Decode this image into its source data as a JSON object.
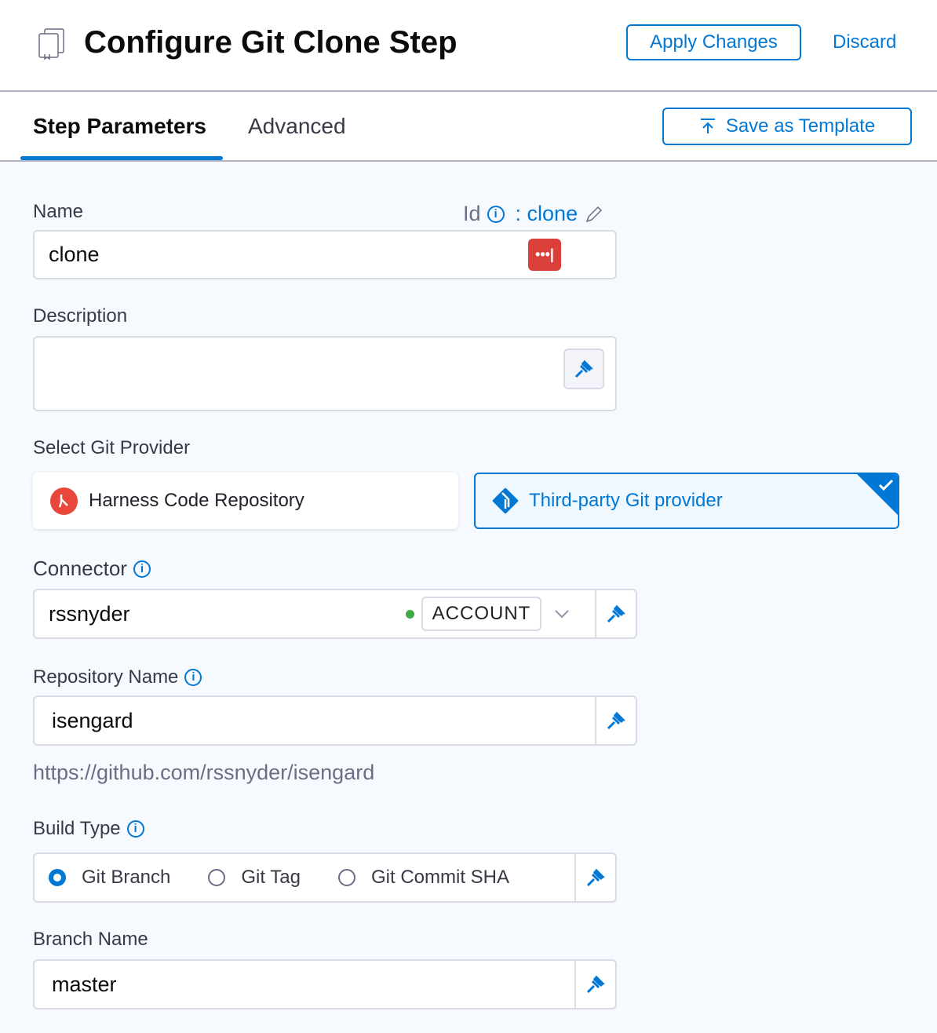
{
  "header": {
    "title": "Configure Git Clone Step",
    "apply_label": "Apply Changes",
    "discard_label": "Discard"
  },
  "tabs": [
    {
      "label": "Step Parameters",
      "active": true
    },
    {
      "label": "Advanced",
      "active": false
    }
  ],
  "save_template_label": "Save as Template",
  "form": {
    "name_label": "Name",
    "id_label": "Id",
    "id_value": ": clone",
    "name_value": "clone",
    "description_label": "Description",
    "description_value": "",
    "provider_label": "Select Git Provider",
    "providers": [
      {
        "label": "Harness Code Repository",
        "selected": false
      },
      {
        "label": "Third-party Git provider",
        "selected": true
      }
    ],
    "connector_label": "Connector",
    "connector_value": "rssnyder",
    "connector_scope": "ACCOUNT",
    "repo_label": "Repository Name",
    "repo_value": "isengard",
    "repo_url": "https://github.com/rssnyder/isengard",
    "build_type_label": "Build Type",
    "build_types": [
      {
        "label": "Git Branch",
        "selected": true
      },
      {
        "label": "Git Tag",
        "selected": false
      },
      {
        "label": "Git Commit SHA",
        "selected": false
      }
    ],
    "branch_label": "Branch Name",
    "branch_value": "master"
  },
  "colors": {
    "accent": "#0278d5",
    "danger": "#db3f3a",
    "harness": "#e8473c",
    "status": "#42ab45"
  }
}
